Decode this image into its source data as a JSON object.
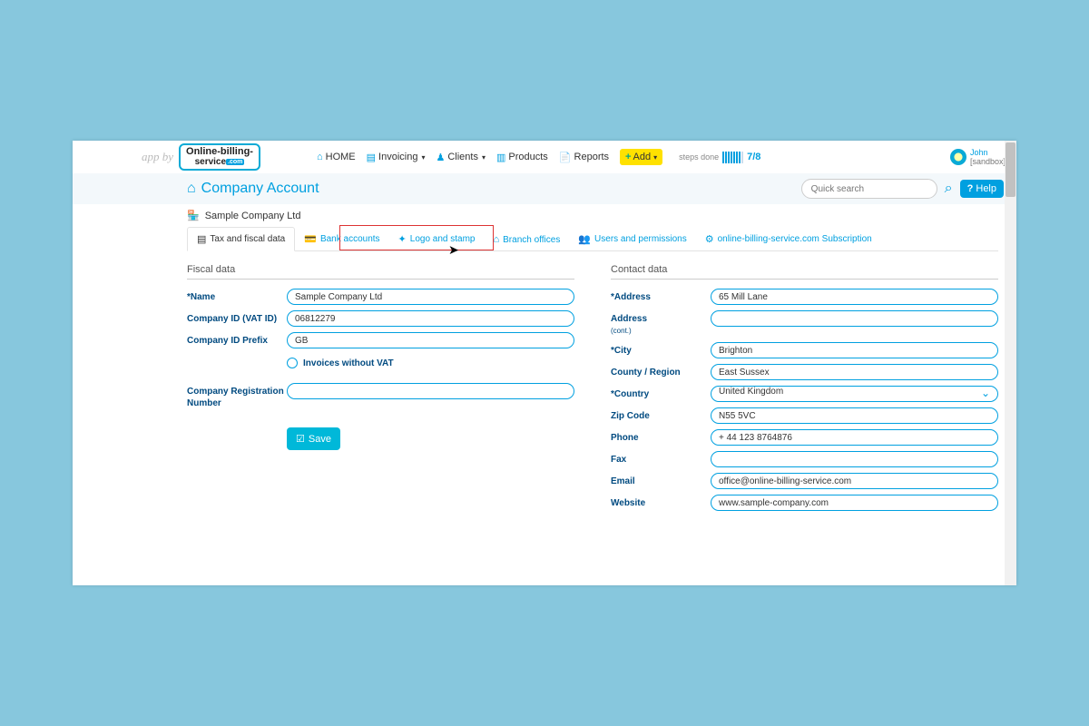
{
  "appby": "app by",
  "logo": {
    "line1": "Online-billing-",
    "line2": "service"
  },
  "nav": {
    "home": "HOME",
    "invoicing": "Invoicing",
    "clients": "Clients",
    "products": "Products",
    "reports": "Reports",
    "add": "Add"
  },
  "steps": {
    "label": "steps done",
    "done": 7,
    "total": 8,
    "ratio": "7/8"
  },
  "user": {
    "name": "John",
    "sub": "[sandbox]"
  },
  "subhead": {
    "title": "Company Account",
    "search_placeholder": "Quick search",
    "help": "Help"
  },
  "company_name": "Sample Company Ltd",
  "tabs": {
    "fiscal": "Tax and fiscal data",
    "bank": "Bank accounts",
    "logo": "Logo and stamp",
    "branch": "Branch offices",
    "users": "Users and permissions",
    "subscription": "online-billing-service.com Subscription"
  },
  "fiscal": {
    "section": "Fiscal data",
    "labels": {
      "name": "*Name",
      "vat": "Company ID (VAT ID)",
      "prefix": "Company ID Prefix",
      "novat": "Invoices without VAT",
      "reg": "Company Registration Number"
    },
    "values": {
      "name": "Sample Company Ltd",
      "vat": "06812279",
      "prefix": "GB",
      "reg": ""
    }
  },
  "contact": {
    "section": "Contact data",
    "labels": {
      "address": "*Address",
      "address2": "Address",
      "address2_sub": "(cont.)",
      "city": "*City",
      "county": "County / Region",
      "country": "*Country",
      "zip": "Zip Code",
      "phone": "Phone",
      "fax": "Fax",
      "email": "Email",
      "website": "Website"
    },
    "values": {
      "address": "65 Mill Lane",
      "address2": "",
      "city": "Brighton",
      "county": "East Sussex",
      "country": "United Kingdom",
      "zip": "N55 5VC",
      "phone": "+ 44 123 8764876",
      "fax": "",
      "email": "office@online-billing-service.com",
      "website": "www.sample-company.com"
    }
  },
  "save": "Save"
}
